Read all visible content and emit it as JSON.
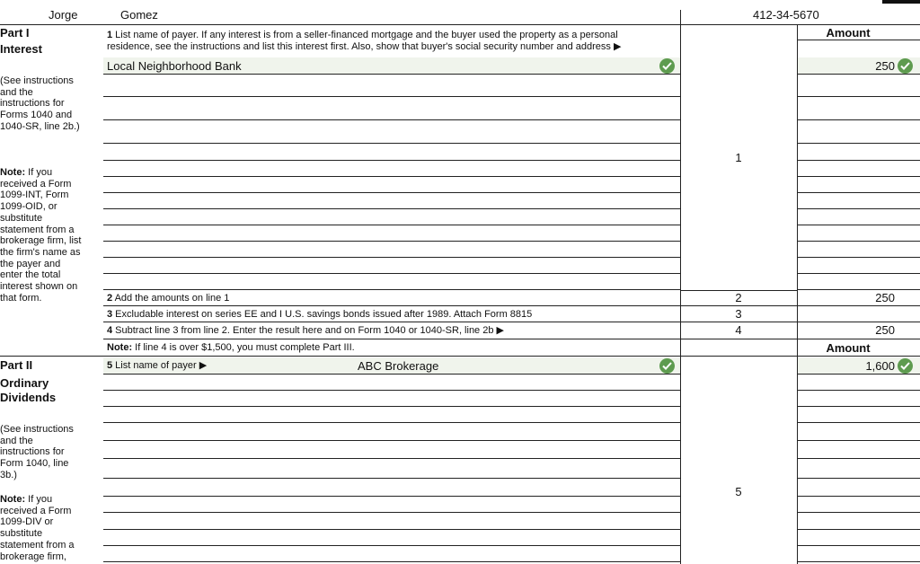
{
  "header": {
    "first_name": "Jorge",
    "last_name": "Gomez",
    "ssn": "412-34-5670"
  },
  "part1": {
    "title": "Part I",
    "subtitle": "Interest",
    "see_instructions": "(See instructions and the instructions for Forms 1040 and 1040-SR, line 2b.)",
    "note_label": "Note:",
    "note_text": " If you received a Form 1099-INT, Form 1099-OID, or substitute statement from a brokerage firm, list the firm's name as the payer and enter the total interest shown on that form.",
    "line1_num": "1",
    "line1_text": " List name of payer. If any interest is from a seller-financed mortgage and the buyer used the property as a personal residence, see the instructions and list this interest first. Also, show that buyer's social security number and address ▶",
    "amount_header": "Amount",
    "payer_entry": "Local Neighborhood Bank",
    "payer_amount": "250",
    "line1_label": "1",
    "line2_num": "2",
    "line2_text": " Add the amounts on line 1",
    "line2_label": "2",
    "line2_amount": "250",
    "line3_num": "3",
    "line3_text": " Excludable interest on series EE and I U.S. savings bonds issued after 1989. Attach Form 8815",
    "line3_label": "3",
    "line4_num": "4",
    "line4_text": " Subtract line 3 from line 2. Enter the result here and on Form 1040 or 1040-SR, line 2b ▶",
    "line4_label": "4",
    "line4_amount": "250",
    "note2_label": "Note:",
    "note2_text": " If line 4 is over $1,500, you must complete Part III.",
    "amount_header2": "Amount"
  },
  "part2": {
    "title": "Part II",
    "subtitle": "Ordinary Dividends",
    "see_instructions": "(See instructions and the instructions for Form 1040, line 3b.)",
    "note_label": "Note:",
    "note_text": " If you received a Form 1099-DIV or substitute statement from a brokerage firm,",
    "line5_num": "5",
    "line5_text": " List name of payer ▶",
    "payer_entry": "ABC Brokerage",
    "payer_amount": "1,600",
    "line5_label": "5"
  },
  "icons": {
    "check": "check-circle-icon"
  },
  "colors": {
    "field_fill": "#f0f4ec",
    "check_green": "#5e9b4f"
  }
}
